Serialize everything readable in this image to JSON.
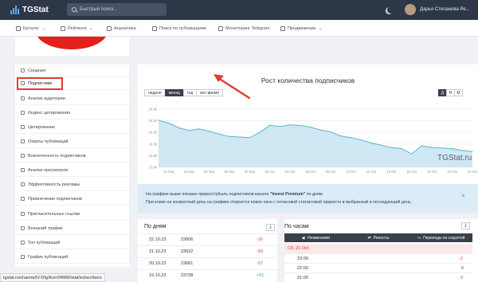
{
  "header": {
    "logo_text": "TGStat",
    "search_placeholder": "Быстрый поиск...",
    "user_name": "Дарья Степанова Ре..."
  },
  "nav": {
    "items": [
      {
        "label": "Каталог",
        "has_dropdown": true
      },
      {
        "label": "Рейтинги",
        "has_dropdown": true
      },
      {
        "label": "Аналитика",
        "has_dropdown": false
      },
      {
        "label": "Поиск по публикациям",
        "has_dropdown": false
      },
      {
        "label": "Мониторинг Telegram",
        "has_dropdown": false
      },
      {
        "label": "Продвижение",
        "has_dropdown": true
      }
    ]
  },
  "sidebar": {
    "items": [
      {
        "label": "Сводная",
        "icon": "globe-icon"
      },
      {
        "label": "Подписчики",
        "icon": "users-icon",
        "active": true
      },
      {
        "label": "Анализ аудитории",
        "icon": "audience-icon"
      },
      {
        "label": "Индекс цитирования",
        "icon": "quote-icon"
      },
      {
        "label": "Цитирование",
        "icon": "quote-icon"
      },
      {
        "label": "Охваты публикаций",
        "icon": "eye-icon"
      },
      {
        "label": "Вовлеченность подписчиков",
        "icon": "heart-icon"
      },
      {
        "label": "Анализ просмотров",
        "icon": "chart-icon"
      },
      {
        "label": "Эффективность рекламы",
        "icon": "bolt-icon"
      },
      {
        "label": "Привлечение подписчиков",
        "icon": "user-plus-icon"
      },
      {
        "label": "Пригласительные ссылки",
        "icon": "link-icon"
      },
      {
        "label": "Внешний трафик",
        "icon": "external-icon"
      },
      {
        "label": "Топ публикаций",
        "icon": "star-icon"
      },
      {
        "label": "График публикаций",
        "icon": "calendar-icon"
      }
    ]
  },
  "chart": {
    "title": "Рост количества подписчиков",
    "periods": [
      {
        "label": "неделя",
        "active": false
      },
      {
        "label": "месяц",
        "active": true
      },
      {
        "label": "год",
        "active": false
      },
      {
        "label": "все время",
        "active": false
      }
    ],
    "granularity": [
      {
        "label": "Д",
        "active": true
      },
      {
        "label": "Н",
        "active": false
      },
      {
        "label": "М",
        "active": false
      }
    ],
    "watermark": "TGStat.ru"
  },
  "chart_data": {
    "type": "area",
    "title": "Рост количества подписчиков",
    "y_ticks": [
      "24.6k",
      "24.4k",
      "24.2k",
      "24.0k",
      "23.8k",
      "23.6k"
    ],
    "ylim": [
      23.6,
      24.6
    ],
    "x_ticks": [
      "22 Sep",
      "24 Sep",
      "26 Sep",
      "28 Sep",
      "30 Sep",
      "02 Oct",
      "04 Oct",
      "06 Oct",
      "08 Oct",
      "10 Oct",
      "12 Oct",
      "14 Oct",
      "16 Oct",
      "18 Oct",
      "20 Oct",
      "22 Oct"
    ],
    "series": [
      {
        "x": [
          "21 Sep",
          "22 Sep",
          "23 Sep",
          "24 Sep",
          "25 Sep",
          "26 Sep",
          "27 Sep",
          "28 Sep",
          "29 Sep",
          "30 Sep",
          "01 Oct",
          "02 Oct",
          "03 Oct",
          "04 Oct",
          "05 Oct",
          "06 Oct",
          "07 Oct",
          "08 Oct",
          "09 Oct",
          "10 Oct",
          "11 Oct",
          "12 Oct",
          "13 Oct",
          "14 Oct",
          "15 Oct",
          "16 Oct",
          "17 Oct",
          "18 Oct",
          "19 Oct",
          "20 Oct",
          "21 Oct",
          "22 Oct"
        ],
        "values": [
          24.41,
          24.36,
          24.28,
          24.23,
          24.26,
          24.22,
          24.17,
          24.13,
          24.12,
          24.11,
          24.2,
          24.32,
          24.3,
          24.33,
          24.32,
          24.29,
          24.24,
          24.21,
          24.14,
          24.11,
          24.07,
          24.02,
          23.98,
          23.94,
          23.92,
          23.83,
          23.97,
          23.94,
          23.93,
          23.92,
          23.89,
          23.87
        ]
      }
    ],
    "grid": true,
    "color": "#5bb4d6"
  },
  "info": {
    "line1_prefix": "На графике выше показан прирост/убыль подписчиков канала",
    "line1_channel": "\"Invest Premium\"",
    "line1_suffix": "по дням.",
    "line2": "При клике на конкретный день на графике откроется новое окно с почасовой статистикой прироста в выбранный и последующий день."
  },
  "by_days": {
    "title": "По дням",
    "rows": [
      {
        "date": "22.10.23",
        "count": "23606",
        "delta": "-16"
      },
      {
        "date": "21.10.23",
        "count": "23622",
        "delta": "-59"
      },
      {
        "date": "20.10.23",
        "count": "23681",
        "delta": "-57"
      },
      {
        "date": "19.10.23",
        "count": "23738",
        "delta": "+51"
      }
    ]
  },
  "by_hours": {
    "title": "По часам",
    "tabs": [
      {
        "label": "Упоминания",
        "icon": "megaphone-icon"
      },
      {
        "label": "Репосты",
        "icon": "share-icon"
      },
      {
        "label": "Переходы из соцсетей",
        "icon": "redirect-icon"
      }
    ],
    "date_label": "Сб, 21 Oct",
    "rows": [
      {
        "time": "23:00",
        "delta": "-2"
      },
      {
        "time": "22:00",
        "delta": "0"
      },
      {
        "time": "21:00",
        "delta": "-3"
      }
    ]
  },
  "status_url": "tgstat.ru/channel/V-Dfg/Kurr04MW/stat/subscribers",
  "colors": {
    "topbar": "#2d3748",
    "accent": "#5bb4d6",
    "highlight": "#e33a31",
    "negative": "#e0463b",
    "positive": "#27ae60"
  }
}
